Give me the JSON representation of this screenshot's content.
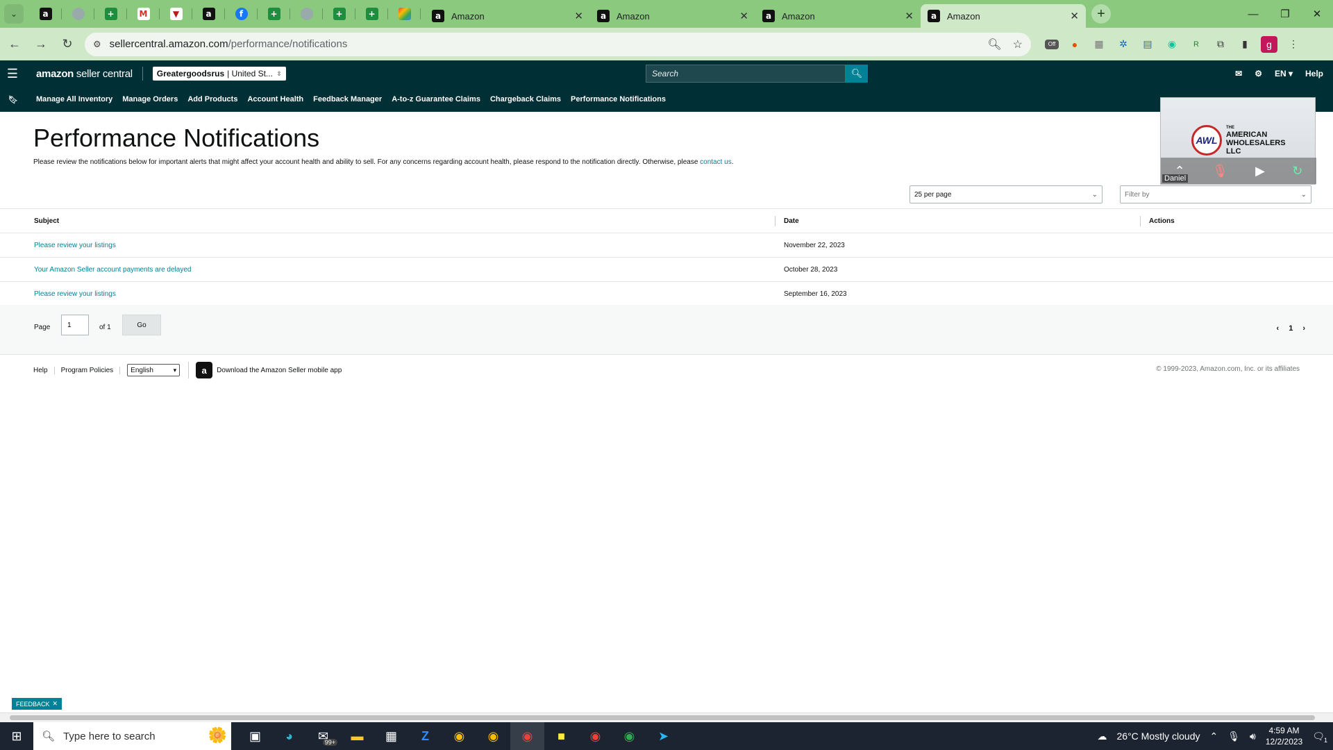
{
  "browser": {
    "pinned_tabs": [
      {
        "icon": "amazon-icon",
        "glyph": "a",
        "cls": "fav-amz"
      },
      {
        "icon": "globe-icon",
        "glyph": "",
        "cls": "fav-globe"
      },
      {
        "icon": "sheets-icon",
        "glyph": "+",
        "cls": "fav-sheet"
      },
      {
        "icon": "gmail-icon",
        "glyph": "M",
        "cls": "fav-gmail"
      },
      {
        "icon": "shield-icon",
        "glyph": "▼",
        "cls": "fav-red"
      },
      {
        "icon": "amazon-icon",
        "glyph": "a",
        "cls": "fav-amz"
      },
      {
        "icon": "facebook-icon",
        "glyph": "f",
        "cls": "fav-fb"
      },
      {
        "icon": "sheets-icon",
        "glyph": "+",
        "cls": "fav-sheet"
      },
      {
        "icon": "globe-icon",
        "glyph": "",
        "cls": "fav-globe"
      },
      {
        "icon": "sheets-icon",
        "glyph": "+",
        "cls": "fav-sheet"
      },
      {
        "icon": "sheets-icon",
        "glyph": "+",
        "cls": "fav-sheet"
      },
      {
        "icon": "multicolor-icon",
        "glyph": "",
        "cls": "fav-multi"
      }
    ],
    "tabs": [
      {
        "title": "Amazon",
        "active": false
      },
      {
        "title": "Amazon",
        "active": false
      },
      {
        "title": "Amazon",
        "active": false
      },
      {
        "title": "Amazon",
        "active": true
      }
    ],
    "url_host": "sellercentral.amazon.com",
    "url_path": "/performance/notifications",
    "profile_initial": "g",
    "extension_badge": "Off"
  },
  "header": {
    "logo_bold": "amazon",
    "logo_light": " seller central",
    "store_name": "Greatergoodsrus",
    "store_region": " | United St...",
    "search_placeholder": "Search",
    "lang": "EN",
    "help": "Help"
  },
  "subnav": {
    "items": [
      "Manage All Inventory",
      "Manage Orders",
      "Add Products",
      "Account Health",
      "Feedback Manager",
      "A-to-z Guarantee Claims",
      "Chargeback Claims",
      "Performance Notifications"
    ]
  },
  "video": {
    "logo_mark": "AWL",
    "logo_text_1": "THE",
    "logo_text_2": "AMERICAN",
    "logo_text_3": "WHOLESALERS",
    "logo_text_4": "LLC",
    "participant": "Daniel"
  },
  "main": {
    "title": "Performance Notifications",
    "description": "Please review the notifications below for important alerts that might affect your account health and ability to sell. For any concerns regarding account health, please respond to the notification directly. Otherwise, please ",
    "contact_link": "contact us",
    "description_end": ".",
    "per_page": "25 per page",
    "filter_placeholder": "Filter by",
    "columns": {
      "subject": "Subject",
      "date": "Date",
      "actions": "Actions"
    },
    "rows": [
      {
        "subject": "Please review your listings",
        "date": "November 22, 2023"
      },
      {
        "subject": "Your Amazon Seller account payments are delayed",
        "date": "October 28, 2023"
      },
      {
        "subject": "Please review your listings",
        "date": "September 16, 2023"
      }
    ],
    "pager": {
      "page_label": "Page",
      "page_value": "1",
      "of_label": "of 1",
      "go_label": "Go",
      "current_page": "1"
    }
  },
  "footer": {
    "help": "Help",
    "program_policies": "Program Policies",
    "language": "English",
    "app_download": "Download the Amazon Seller mobile app",
    "copyright": "© 1999-2023, Amazon.com, Inc. or its affiliates"
  },
  "feedback_label": "FEEDBACK",
  "taskbar": {
    "search_placeholder": "Type here to search",
    "mail_badge": "99+",
    "weather": "26°C  Mostly cloudy",
    "time": "4:59 AM",
    "date": "12/2/2023",
    "notification_count": "1"
  }
}
